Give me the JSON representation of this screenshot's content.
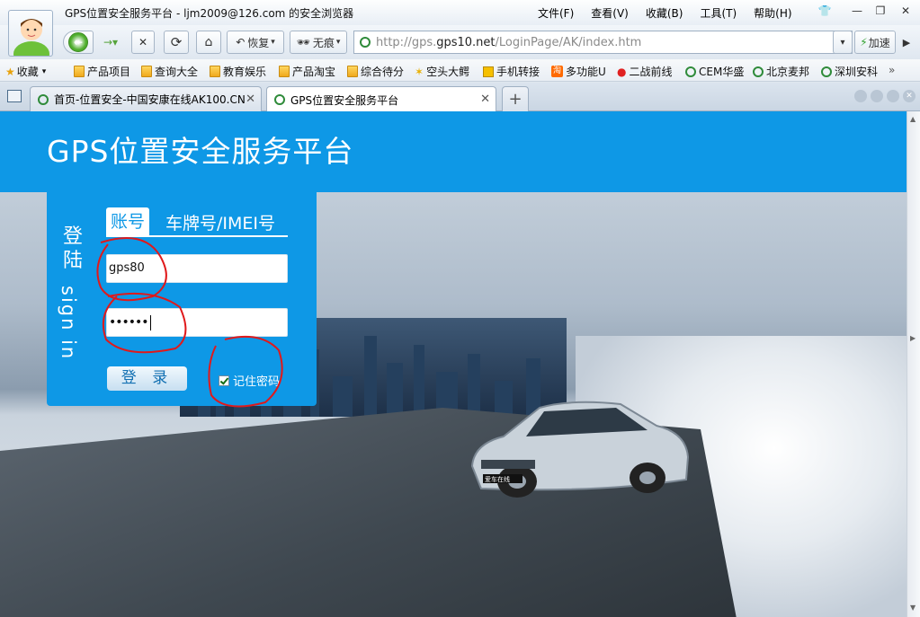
{
  "window": {
    "title": "GPS位置安全服务平台 - ljm2009@126.com 的安全浏览器",
    "menu": [
      "文件(F)",
      "查看(V)",
      "收藏(B)",
      "工具(T)",
      "帮助(H)"
    ]
  },
  "toolbar": {
    "restore_label": "恢复",
    "incognito_label": "无痕",
    "speed_label": "加速"
  },
  "address": {
    "url_prefix": "http://gps.",
    "url_domain": "gps10.net",
    "url_path": "/LoginPage/AK/index.htm"
  },
  "bookmarks": [
    "收藏",
    "产品项目",
    "查询大全",
    "教育娱乐",
    "产品淘宝",
    "综合待分",
    "空头大鳄",
    "手机转接",
    "多功能U",
    "二战前线",
    "CEM华盛",
    "北京麦邦",
    "深圳安科"
  ],
  "tabs": [
    {
      "label": "首页-位置安全-中国安康在线AK100.CN",
      "active": false
    },
    {
      "label": "GPS位置安全服务平台",
      "active": true
    }
  ],
  "page": {
    "header_title": "GPS位置安全服务平台",
    "side_cn": "登陆",
    "side_en": "sign in",
    "tab_account": "账号",
    "tab_plate": "车牌号/IMEI号",
    "username_value": "gps80",
    "password_mask": "••••••",
    "login_button": "登 录",
    "remember_label": "记住密码",
    "remember_checked": true,
    "car_plate_text": "爱车在线"
  },
  "colors": {
    "brand_blue": "#0e98e6",
    "annotation_red": "#e0191b"
  }
}
